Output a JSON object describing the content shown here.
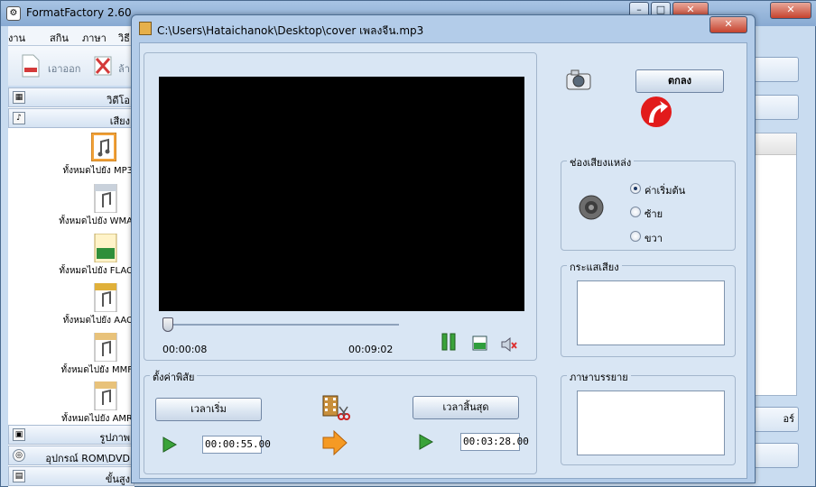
{
  "main_window": {
    "title": "FormatFactory 2.60",
    "controls": {
      "minimize": "–",
      "maximize": "□",
      "close": "✕"
    },
    "menu": [
      "งาน",
      "สกิน",
      "ภาษา",
      "วิธี"
    ],
    "toolbar": {
      "remove_label": "เอาออก",
      "clear_label": "ล้า"
    },
    "sidebar": {
      "categories": {
        "video": "วิดีโอ",
        "audio": "เสียง",
        "picture": "รูปภาพ",
        "rom": "อุปกรณ์ ROM\\DVD",
        "advanced": "ขั้นสูง"
      },
      "formats": [
        {
          "badge": "MP3",
          "label": "ทั้งหมดไปยัง MP3"
        },
        {
          "badge": "WMA",
          "label": "ทั้งหมดไปยัง WMA"
        },
        {
          "badge": "fla",
          "label": "ทั้งหมดไปยัง FLAC"
        },
        {
          "badge": "AAC",
          "label": "ทั้งหมดไปยัง AAC"
        },
        {
          "badge": "MMF",
          "label": "ทั้งหมดไปยัง MMF"
        },
        {
          "badge": "AMR",
          "label": "ทั้งหมดไปยัง AMR"
        }
      ]
    },
    "right": {
      "folder_button": "อร์"
    }
  },
  "dialog": {
    "title": "C:\\Users\\Hataichanok\\Desktop\\cover เพลงจีน.mp3",
    "close": "✕",
    "ok_label": "ตกลง",
    "player": {
      "current_time": "00:00:08",
      "total_time": "00:09:02",
      "seek_position": 0.015
    },
    "audio_channel": {
      "title": "ช่องเสียงแหล่ง",
      "options": [
        "ค่าเริ่มต้น",
        "ซ้าย",
        "ขวา"
      ],
      "selected": 0
    },
    "audio_stream": {
      "title": "กระแสเสียง"
    },
    "subtitle": {
      "title": "ภาษาบรรยาย"
    },
    "settings": {
      "title": "ตั้งค่าพิสัย",
      "start_label": "เวลาเริ่ม",
      "end_label": "เวลาสิ้นสุด",
      "start_time": "00:00:55.00",
      "end_time": "00:03:28.00"
    }
  }
}
